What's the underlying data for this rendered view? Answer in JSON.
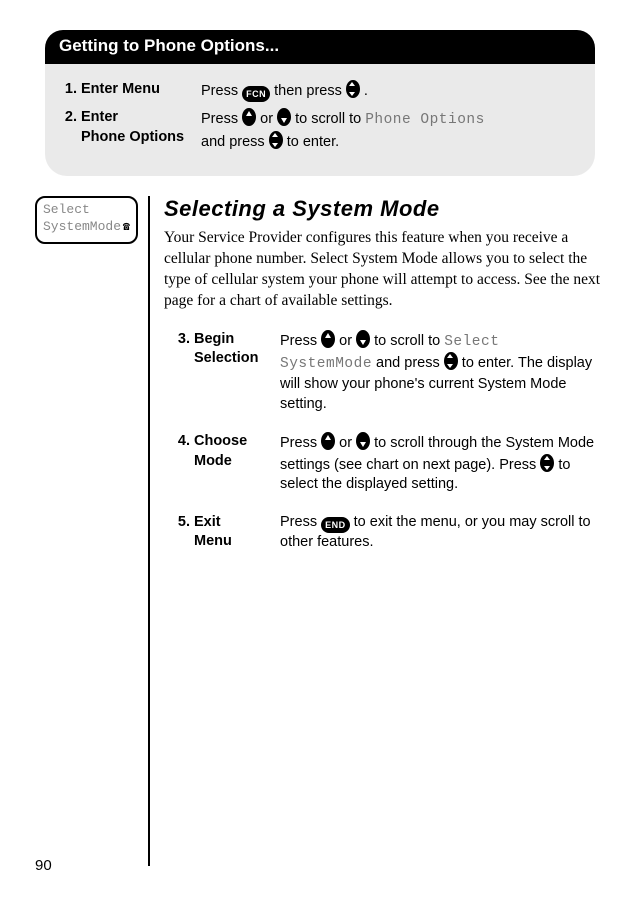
{
  "header": {
    "title": "Getting to Phone Options..."
  },
  "opt_steps": [
    {
      "num": "1.",
      "label": "Enter Menu",
      "desc_a": "Press ",
      "key1": "FCN",
      "desc_b": " then press ",
      "key2": "updown",
      "desc_c": "."
    },
    {
      "num": "2.",
      "label_line1": "Enter",
      "label_line2": "Phone Options",
      "desc_a": "Press ",
      "key1": "up",
      "desc_b": " or ",
      "key2": "down",
      "desc_c": " to scroll to ",
      "lcd": "Phone Options",
      "desc_d": "and press ",
      "key3": "updown",
      "desc_e": " to enter."
    }
  ],
  "side_screen": {
    "line1": "Select",
    "line2": "SystemMode",
    "icon": "phone-icon"
  },
  "section": {
    "title": "Selecting a System Mode",
    "intro": "Your Service Provider configures this feature when you receive a cellular phone number. Select System Mode allows you to select the type of cellular system your phone will attempt to access. See the next page for a chart of available settings."
  },
  "steps": [
    {
      "num": "3.",
      "label_line1": "Begin",
      "label_line2": "Selection",
      "desc_a": "Press ",
      "key1": "up",
      "desc_b": " or ",
      "key2": "down",
      "desc_c": " to scroll to ",
      "lcd1": "Select",
      "lcd2": "SystemMode",
      "desc_d": " and press ",
      "key3": "updown",
      "desc_e": " to enter. The display will show your phone's current System Mode setting."
    },
    {
      "num": "4.",
      "label_line1": "Choose",
      "label_line2": "Mode",
      "desc_a": "Press ",
      "key1": "up",
      "desc_b": " or ",
      "key2": "down",
      "desc_c": " to scroll through the System Mode settings (see chart on next page). Press ",
      "key3": "updown",
      "desc_d": " to select the displayed setting."
    },
    {
      "num": "5.",
      "label_line1": "Exit",
      "label_line2": "Menu",
      "desc_a": "Press ",
      "key1": "END",
      "desc_b": " to exit the menu, or you may scroll to other features."
    }
  ],
  "page_number": "90"
}
